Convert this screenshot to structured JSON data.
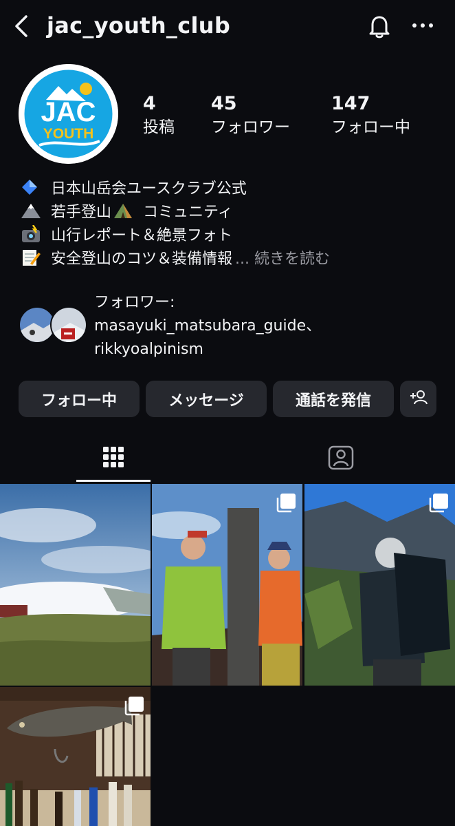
{
  "header": {
    "username": "jac_youth_club",
    "back_icon": "chevron-left-icon",
    "bell_icon": "bell-icon",
    "more_icon": "more-horizontal-icon"
  },
  "profile": {
    "avatar_text_top": "JAC",
    "avatar_text_bottom": "YOUTH",
    "stats": [
      {
        "value": "4",
        "label": "投稿"
      },
      {
        "value": "45",
        "label": "フォロワー"
      },
      {
        "value": "147",
        "label": "フォロー中"
      }
    ],
    "bio": [
      {
        "icon": "blue-diamond-icon",
        "text": "日本山岳会ユースクラブ公式"
      },
      {
        "icon": "mountain-icon",
        "text": "若手登山",
        "trailing_icon": "tent-icon",
        "text2": "コミュニティ"
      },
      {
        "icon": "camera-flash-icon",
        "text": "山行レポート＆絶景フォト"
      },
      {
        "icon": "memo-icon",
        "text": "安全登山のコツ＆装備情報",
        "more": "... 続きを読む"
      }
    ],
    "followed_by_label": "フォロワー:",
    "followed_by_1": "masayuki_matsubara_guide、",
    "followed_by_2": "rikkyoalpinism"
  },
  "actions": {
    "following": "フォロー中",
    "message": "メッセージ",
    "call": "通話を発信",
    "add_person_icon": "add-person-icon"
  },
  "tabs": {
    "grid_icon": "grid-icon",
    "tagged_icon": "tagged-person-icon"
  },
  "colors": {
    "background": "#0b0c10",
    "button": "#26282e",
    "muted_text": "#9b9ca3",
    "avatar_blue": "#16a6e3",
    "avatar_yellow": "#f4c21b"
  }
}
